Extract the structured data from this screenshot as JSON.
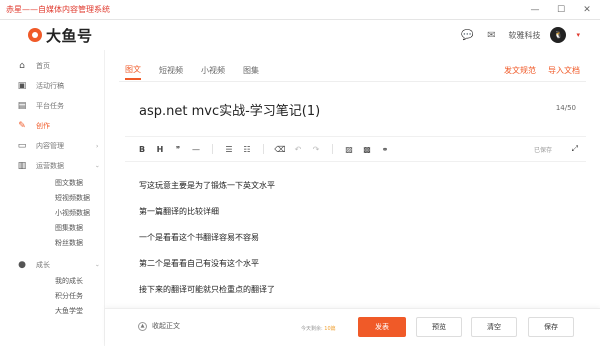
{
  "window": {
    "title": "赤星——自媒体内容管理系统",
    "min": "—",
    "max": "☐",
    "close": "✕"
  },
  "header": {
    "logo_text": "大鱼号",
    "username": "软雅科技",
    "avatar_text": "🐧",
    "caret": "▾",
    "chat_icon": "💬",
    "mail_icon": "✉"
  },
  "sidebar": {
    "items": [
      {
        "label": "首页",
        "icon": "⌂"
      },
      {
        "label": "活动行稿",
        "icon": "▣"
      },
      {
        "label": "平台任务",
        "icon": "▤"
      },
      {
        "label": "创作",
        "icon": "✎"
      },
      {
        "label": "内容管理",
        "icon": "▭"
      },
      {
        "label": "运营数据",
        "icon": "▥"
      },
      {
        "label": "成长",
        "icon": "●"
      }
    ],
    "data_sub": [
      "图文数据",
      "短视频数据",
      "小视频数据",
      "图集数据",
      "粉丝数据"
    ],
    "growth_sub": [
      "我的成长",
      "积分任务",
      "大鱼学堂"
    ],
    "arrow": "›"
  },
  "tabs": {
    "items": [
      "图文",
      "短视频",
      "小视频",
      "图集"
    ],
    "links": [
      "发文规范",
      "导入文档"
    ]
  },
  "editor": {
    "title": "asp.net mvc实战-学习笔记(1)",
    "counter": "14/50",
    "saved": "已保存",
    "expand": "⤢",
    "toolbar": {
      "bold": "B",
      "heading": "H",
      "quote": "❞",
      "hr": "—",
      "ol": "☰",
      "ul": "☷",
      "eraser": "⌫",
      "undo": "↶",
      "redo": "↷",
      "image": "▨",
      "video": "▩",
      "link": "⚭"
    },
    "paragraphs": [
      "写这玩意主要是为了锻炼一下英文水平",
      "第一篇翻译的比较详细",
      "一个是看看这个书翻译容易不容易",
      "第二个是看看自己有没有这个水平",
      "接下来的翻译可能就只检重点的翻译了"
    ]
  },
  "bottom": {
    "collapse": "收起正文",
    "collapse_icon": "▲",
    "words_prefix": "今天剩余:",
    "words_count": "10篇",
    "publish": "发表",
    "preview": "预览",
    "clear": "清空",
    "save": "保存"
  },
  "colors": {
    "accent": "#f05a28",
    "title_red": "#e03a2e"
  }
}
